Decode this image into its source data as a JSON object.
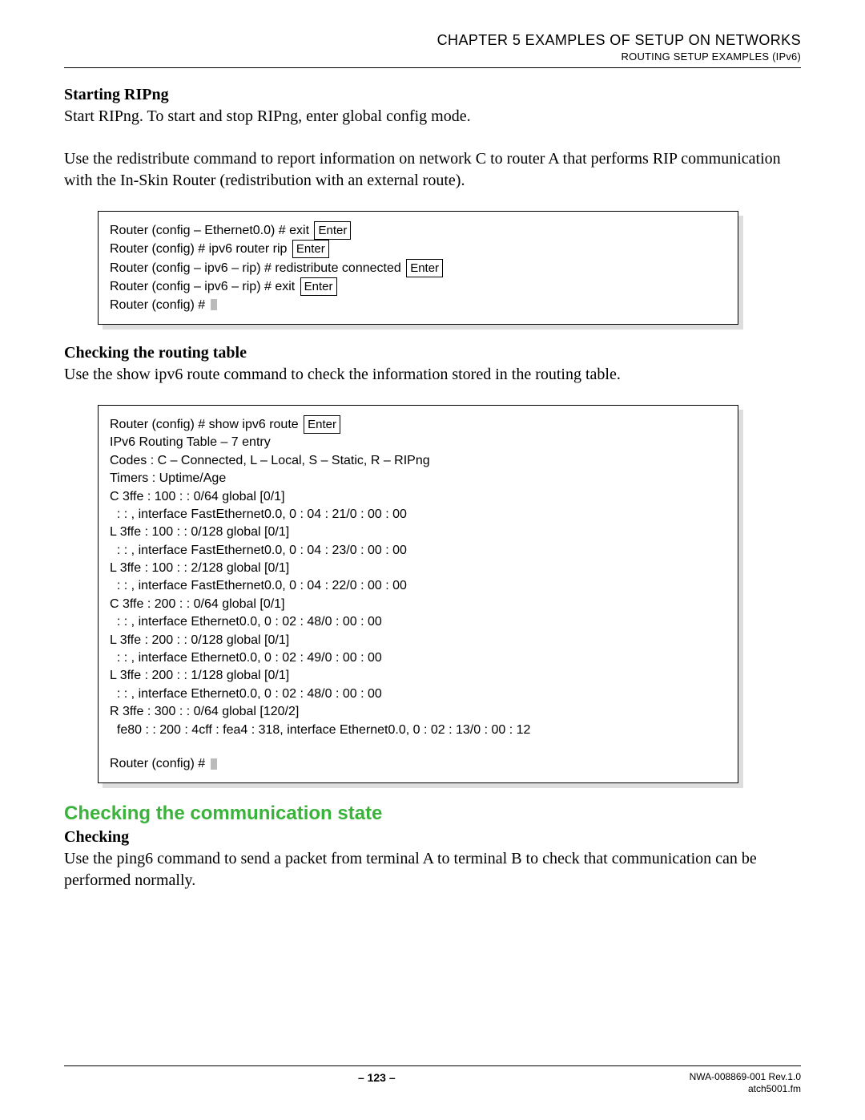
{
  "header": {
    "chapter": "CHAPTER 5   EXAMPLES OF SETUP ON NETWORKS",
    "sub": "ROUTING SETUP EXAMPLES (IPv6)"
  },
  "sec1": {
    "title": "Starting RIPng",
    "p1": "Start RIPng. To start and stop RIPng, enter global config mode.",
    "p2": "Use the redistribute command to report information on network C to router A that performs RIP communication with the In-Skin Router (redistribution with an external route)."
  },
  "box1": {
    "l1": "Router (config – Ethernet0.0) # exit",
    "l2": "Router (config) # ipv6 router rip",
    "l3": "Router (config – ipv6 – rip) # redistribute connected",
    "l4": "Router (config – ipv6 – rip) # exit",
    "l5": "Router (config) #",
    "enter": "Enter"
  },
  "sec2": {
    "title": "Checking the routing table",
    "p1": "Use the show ipv6 route command to check the information stored in the routing table."
  },
  "box2": {
    "l1": "Router (config) # show ipv6 route",
    "l2": "IPv6 Routing Table – 7 entry",
    "l3": "Codes : C – Connected, L – Local, S – Static, R – RIPng",
    "l4": "Timers : Uptime/Age",
    "l5": "C 3ffe : 100 : : 0/64 global [0/1]",
    "l6": "  : : , interface FastEthernet0.0, 0 : 04 : 21/0 : 00 : 00",
    "l7": "L 3ffe : 100 : : 0/128 global [0/1]",
    "l8": "  : : , interface FastEthernet0.0, 0 : 04 : 23/0 : 00 : 00",
    "l9": "L 3ffe : 100 : : 2/128 global [0/1]",
    "l10": "  : : , interface FastEthernet0.0, 0 : 04 : 22/0 : 00 : 00",
    "l11": "C 3ffe : 200 : : 0/64 global [0/1]",
    "l12": "  : : , interface Ethernet0.0, 0 : 02 : 48/0 : 00 : 00",
    "l13": "L 3ffe : 200 : : 0/128 global [0/1]",
    "l14": "  : : , interface Ethernet0.0, 0 : 02 : 49/0 : 00 : 00",
    "l15": "L 3ffe : 200 : : 1/128 global [0/1]",
    "l16": "  : : , interface Ethernet0.0, 0 : 02 : 48/0 : 00 : 00",
    "l17": "R 3ffe : 300 : : 0/64 global [120/2]",
    "l18": "  fe80 : : 200 : 4cff : fea4 : 318, interface Ethernet0.0, 0 : 02 : 13/0 : 00 : 12",
    "l19": "Router (config) #",
    "enter": "Enter"
  },
  "sec3": {
    "green": "Checking the communication state",
    "title": "Checking",
    "p1": "Use the ping6 command to send a packet from terminal A to terminal B to check that communication can be performed normally."
  },
  "footer": {
    "page": "– 123 –",
    "doc1": "NWA-008869-001 Rev.1.0",
    "doc2": "atch5001.fm"
  }
}
